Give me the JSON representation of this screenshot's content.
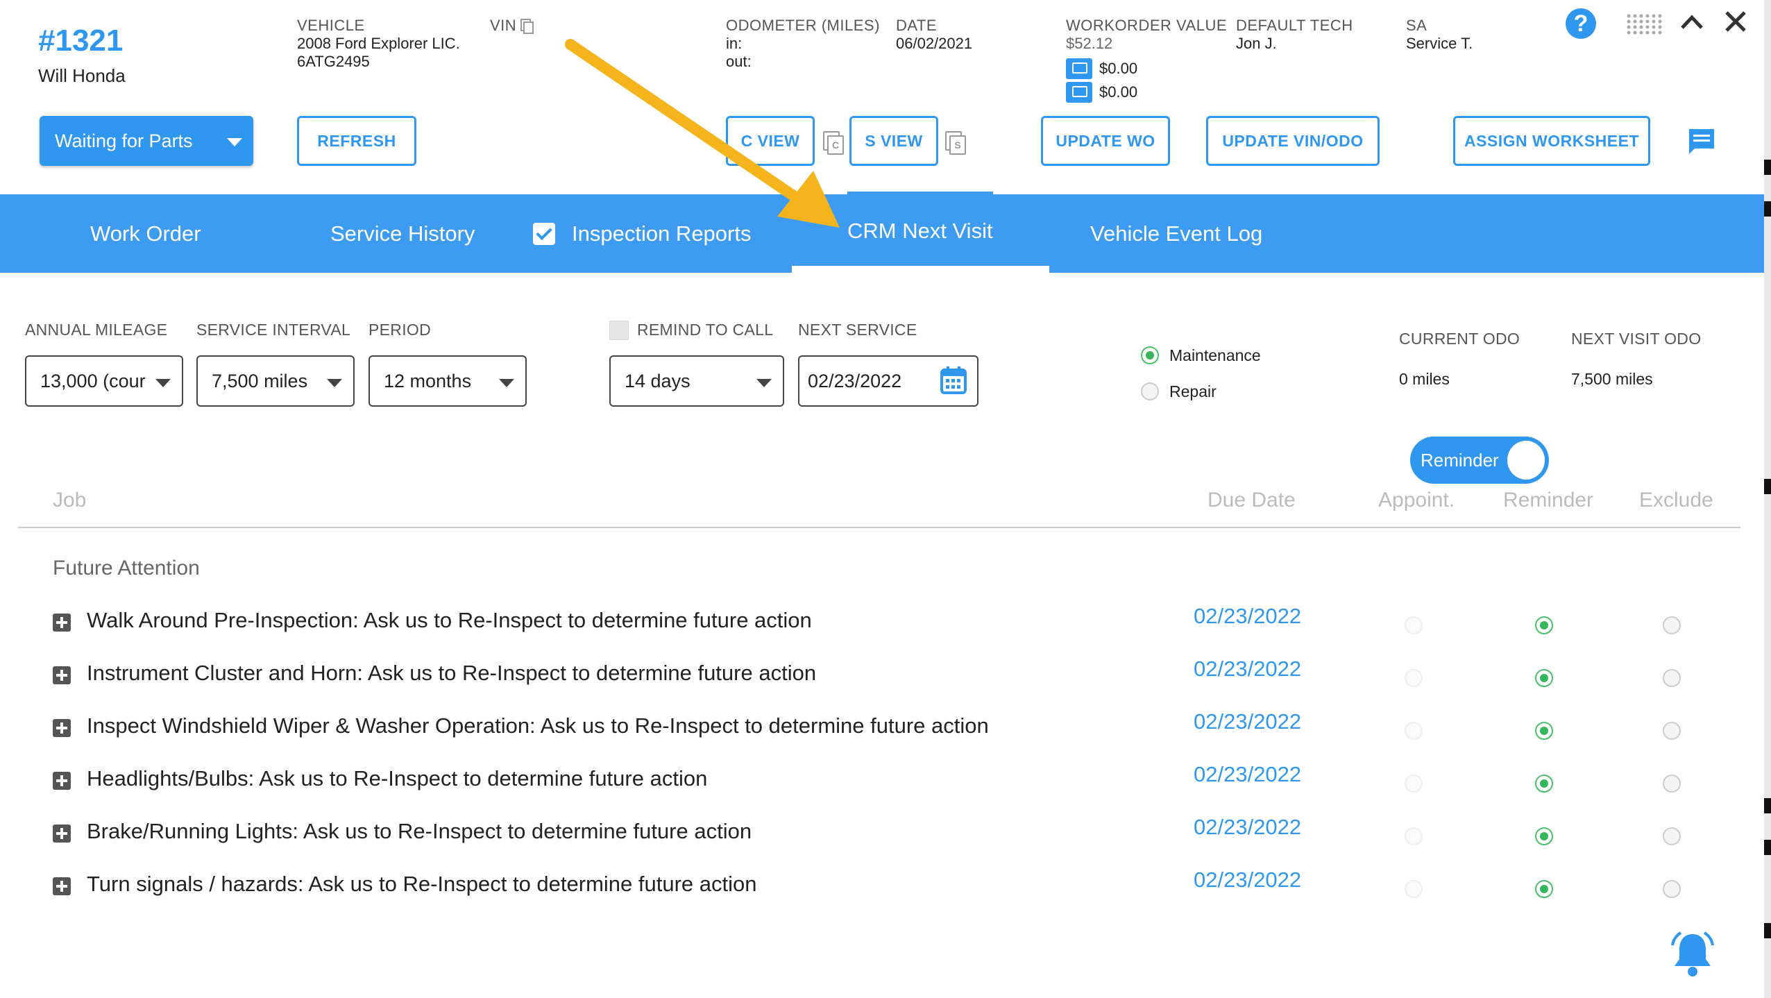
{
  "header": {
    "wo_number": "#1321",
    "customer": "Will Honda",
    "vehicle_label": "VEHICLE",
    "vehicle_line1": "2008 Ford Explorer LIC.",
    "vehicle_line2": "6ATG2495",
    "vin_label": "VIN",
    "odometer_label": "ODOMETER (MILES)",
    "odometer_in": "in:",
    "odometer_out": "out:",
    "date_label": "DATE",
    "date_value": "06/02/2021",
    "wo_value_label": "WORKORDER VALUE",
    "wo_value": "$52.12",
    "price1": "$0.00",
    "price2": "$0.00",
    "tech_label": "DEFAULT TECH",
    "tech_value": "Jon J.",
    "sa_label": "SA",
    "sa_value": "Service T."
  },
  "toolbar": {
    "status": "Waiting for Parts",
    "refresh": "REFRESH",
    "c_view": "C VIEW",
    "s_view": "S VIEW",
    "update_wo": "UPDATE WO",
    "update_vin_odo": "UPDATE VIN/ODO",
    "assign_worksheet": "ASSIGN WORKSHEET"
  },
  "tabs": {
    "work_order": "Work Order",
    "service_history": "Service History",
    "inspection_reports": "Inspection Reports",
    "crm_next_visit": "CRM Next Visit",
    "vehicle_event_log": "Vehicle Event Log"
  },
  "form": {
    "annual_mileage_label": "ANNUAL MILEAGE",
    "annual_mileage_value": "13,000 (cour",
    "service_interval_label": "SERVICE INTERVAL",
    "service_interval_value": "7,500 miles",
    "period_label": "PERIOD",
    "period_value": "12 months",
    "remind_label": "REMIND TO CALL",
    "remind_value": "14 days",
    "next_service_label": "NEXT SERVICE",
    "next_service_value": "02/23/2022",
    "maintenance": "Maintenance",
    "repair": "Repair",
    "current_odo_label": "CURRENT ODO",
    "current_odo_value": "0 miles",
    "next_odo_label": "NEXT VISIT ODO",
    "next_odo_value": "7,500 miles",
    "reminder_toggle": "Reminder"
  },
  "table": {
    "headers": {
      "job": "Job",
      "due_date": "Due Date",
      "appoint": "Appoint.",
      "reminder": "Reminder",
      "exclude": "Exclude"
    },
    "section": "Future Attention",
    "rows": [
      {
        "job": "Walk Around Pre-Inspection: Ask us to Re-Inspect to determine future action",
        "date": "02/23/2022"
      },
      {
        "job": "Instrument Cluster and Horn: Ask us to Re-Inspect to determine future action",
        "date": "02/23/2022"
      },
      {
        "job": "Inspect Windshield Wiper & Washer Operation: Ask us to Re-Inspect to determine future action",
        "date": "02/23/2022"
      },
      {
        "job": "Headlights/Bulbs: Ask us to Re-Inspect to determine future action",
        "date": "02/23/2022"
      },
      {
        "job": "Brake/Running Lights: Ask us to Re-Inspect to determine future action",
        "date": "02/23/2022"
      },
      {
        "job": "Turn signals / hazards: Ask us to Re-Inspect to determine future action",
        "date": "02/23/2022"
      }
    ]
  },
  "colors": {
    "accent": "#2f97ef",
    "tabbar": "#3d9cf1",
    "arrow": "#f5b41c",
    "radio_on": "#33b75a"
  }
}
